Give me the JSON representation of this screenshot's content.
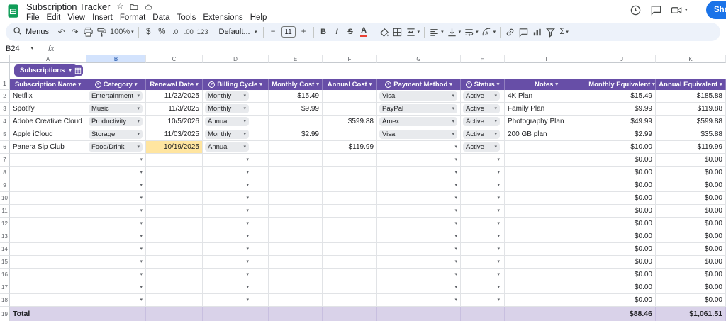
{
  "app": {
    "title": "Subscription Tracker",
    "menus": [
      "File",
      "Edit",
      "View",
      "Insert",
      "Format",
      "Data",
      "Tools",
      "Extensions",
      "Help"
    ],
    "share_label": "Share"
  },
  "toolbar": {
    "menus_label": "Menus",
    "zoom_value": "100%",
    "font_name": "Default...",
    "font_size": "11",
    "glyphs": {
      "undo": "↶",
      "redo": "↷",
      "currency": "$",
      "percent": "%",
      "decimal_decrease": ".0",
      "decimal_increase": ".00",
      "number_format": "123",
      "minus": "−",
      "plus": "+",
      "bold": "B",
      "italic": "I",
      "strikethrough": "S",
      "text_color": "A",
      "functions": "Σ"
    }
  },
  "formula_bar": {
    "cell_ref": "B24",
    "fx_label": "fx"
  },
  "sheet": {
    "tab": {
      "name": "Subscriptions"
    },
    "selected_column": "B",
    "column_letters": [
      "A",
      "B",
      "C",
      "D",
      "E",
      "F",
      "G",
      "H",
      "I",
      "J",
      "K"
    ],
    "header_row_number": "1",
    "headers": [
      {
        "label": "Subscription Name",
        "type_icon": false
      },
      {
        "label": "Category",
        "type_icon": true
      },
      {
        "label": "Renewal Date",
        "type_icon": false
      },
      {
        "label": "Billing Cycle",
        "type_icon": true
      },
      {
        "label": "Monthly Cost",
        "type_icon": false
      },
      {
        "label": "Annual Cost",
        "type_icon": false
      },
      {
        "label": "Payment Method",
        "type_icon": true
      },
      {
        "label": "Status",
        "type_icon": true
      },
      {
        "label": "Notes",
        "type_icon": false
      },
      {
        "label": "Monthly Equivalent",
        "type_icon": false
      },
      {
        "label": "Annual Equivalent",
        "type_icon": false
      }
    ],
    "rows": [
      {
        "num": "2",
        "name": "Netflix",
        "category": "Entertainment",
        "renewal_date": "11/22/2025",
        "highlight": false,
        "billing_cycle": "Monthly",
        "monthly_cost": "$15.49",
        "annual_cost": "",
        "payment_method": "Visa",
        "status": "Active",
        "notes": "4K Plan",
        "monthly_eq": "$15.49",
        "annual_eq": "$185.88"
      },
      {
        "num": "3",
        "name": "Spotify",
        "category": "Music",
        "renewal_date": "11/3/2025",
        "highlight": false,
        "billing_cycle": "Monthly",
        "monthly_cost": "$9.99",
        "annual_cost": "",
        "payment_method": "PayPal",
        "status": "Active",
        "notes": "Family Plan",
        "monthly_eq": "$9.99",
        "annual_eq": "$119.88"
      },
      {
        "num": "4",
        "name": "Adobe Creative Cloud",
        "category": "Productivity",
        "renewal_date": "10/5/2026",
        "highlight": false,
        "billing_cycle": "Annual",
        "monthly_cost": "",
        "annual_cost": "$599.88",
        "payment_method": "Amex",
        "status": "Active",
        "notes": "Photography Plan",
        "monthly_eq": "$49.99",
        "annual_eq": "$599.88"
      },
      {
        "num": "5",
        "name": "Apple iCloud",
        "category": "Storage",
        "renewal_date": "11/03/2025",
        "highlight": false,
        "billing_cycle": "Monthly",
        "monthly_cost": "$2.99",
        "annual_cost": "",
        "payment_method": "Visa",
        "status": "Active",
        "notes": "200 GB plan",
        "monthly_eq": "$2.99",
        "annual_eq": "$35.88"
      },
      {
        "num": "6",
        "name": "Panera Sip Club",
        "category": "Food/Drink",
        "renewal_date": "10/19/2025",
        "highlight": true,
        "billing_cycle": "Annual",
        "monthly_cost": "",
        "annual_cost": "$119.99",
        "payment_method": "",
        "status": "Active",
        "notes": "",
        "monthly_eq": "$10.00",
        "annual_eq": "$119.99"
      }
    ],
    "empty_rows": {
      "nums": [
        "7",
        "8",
        "9",
        "10",
        "11",
        "12",
        "13",
        "14",
        "15",
        "16",
        "17",
        "18"
      ],
      "monthly_eq": "$0.00",
      "annual_eq": "$0.00"
    },
    "total_row": {
      "num": "19",
      "label": "Total",
      "monthly_eq": "$88.46",
      "annual_eq": "$1,061.51"
    }
  },
  "colors": {
    "header_purple": "#674ea7",
    "total_row_bg": "#d9d2e9",
    "date_highlight": "#ffe5a0",
    "share_blue": "#1a73e8",
    "sheets_green": "#0f9d58"
  }
}
